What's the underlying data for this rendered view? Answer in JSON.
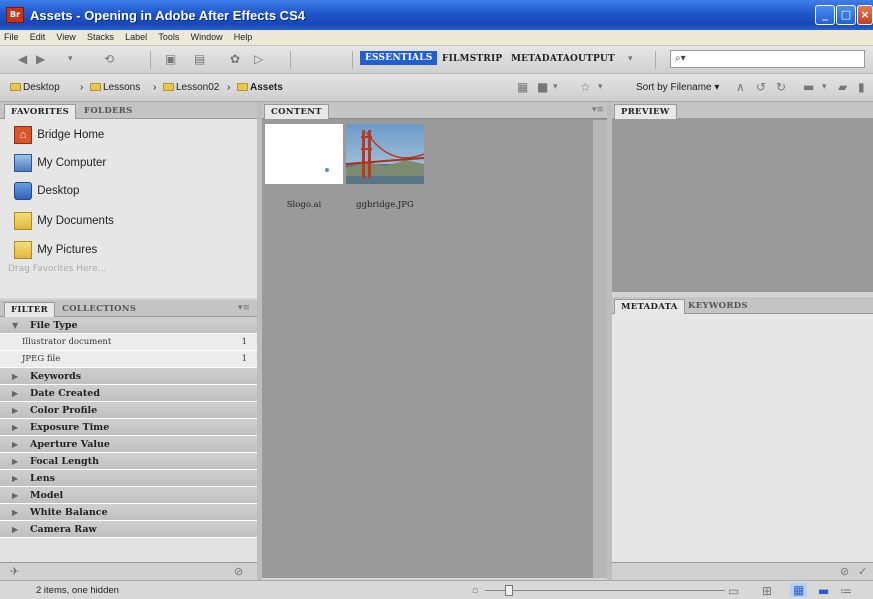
{
  "window": {
    "title": "Assets - Opening in Adobe After Effects CS4",
    "app_badge": "Br"
  },
  "menu": [
    "File",
    "Edit",
    "View",
    "Stacks",
    "Label",
    "Tools",
    "Window",
    "Help"
  ],
  "workspaces": [
    "ESSENTIALS",
    "FILMSTRIP",
    "METADATA",
    "OUTPUT"
  ],
  "search": {
    "glyph": "⌕▾"
  },
  "breadcrumb": [
    "Desktop",
    "Lessons",
    "Lesson02",
    "Assets"
  ],
  "sort": {
    "label": "Sort by Filename"
  },
  "left_top_tabs": [
    "FAVORITES",
    "FOLDERS"
  ],
  "favorites": [
    "Bridge Home",
    "My Computer",
    "Desktop",
    "My Documents",
    "My Pictures"
  ],
  "drag_hint": "Drag Favorites Here...",
  "left_bottom_tabs": [
    "FILTER",
    "COLLECTIONS"
  ],
  "filter": {
    "file_type": "File Type",
    "items": [
      {
        "label": "Illustrator document",
        "count": "1"
      },
      {
        "label": "JPEG file",
        "count": "1"
      }
    ],
    "headers": [
      "Keywords",
      "Date Created",
      "Color Profile",
      "Exposure Time",
      "Aperture Value",
      "Focal Length",
      "Lens",
      "Model",
      "White Balance",
      "Camera Raw"
    ]
  },
  "content": {
    "tab": "CONTENT",
    "thumbnails": [
      {
        "name": "Slogo.ai"
      },
      {
        "name": "ggbridge.JPG"
      }
    ]
  },
  "preview_tab": "PREVIEW",
  "meta_tabs": [
    "METADATA",
    "KEYWORDS"
  ],
  "status": "2 items, one hidden",
  "colors": {
    "title_bar": "#1f56cc",
    "accent": "#1f5fd0",
    "content_bg": "#9a9a9a"
  }
}
